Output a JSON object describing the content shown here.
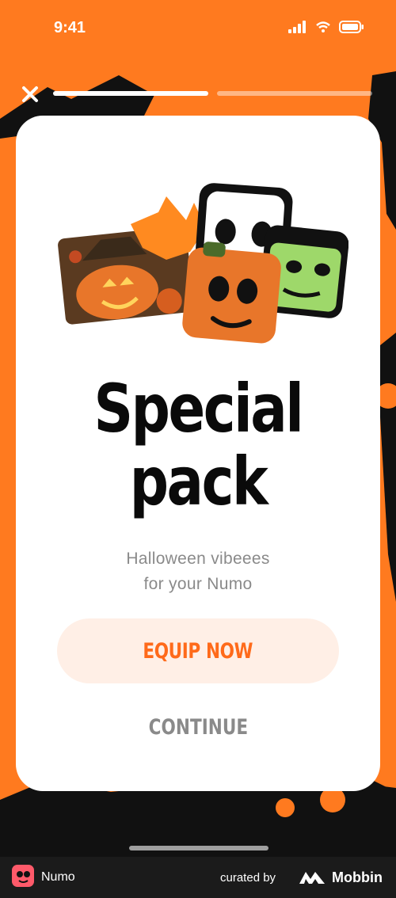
{
  "status_bar": {
    "time": "9:41"
  },
  "story": {
    "close_label": "×"
  },
  "card": {
    "title_line1": "Special",
    "title_line2": "pack",
    "subtitle_line1": "Halloween vibeees",
    "subtitle_line2": "for your Numo",
    "equip_label": "EQUIP NOW",
    "continue_label": "CONTINUE"
  },
  "footer": {
    "app_name": "Numo",
    "curated_by": "curated by",
    "brand": "Mobbin"
  },
  "colors": {
    "background": "#FF7A1F",
    "accent": "#FF6A1A",
    "button_bg": "#FFEFE6",
    "card": "#FFFFFF"
  },
  "icons": [
    "signal-icon",
    "wifi-icon",
    "battery-icon",
    "close-icon",
    "mobbin-logo-icon"
  ]
}
